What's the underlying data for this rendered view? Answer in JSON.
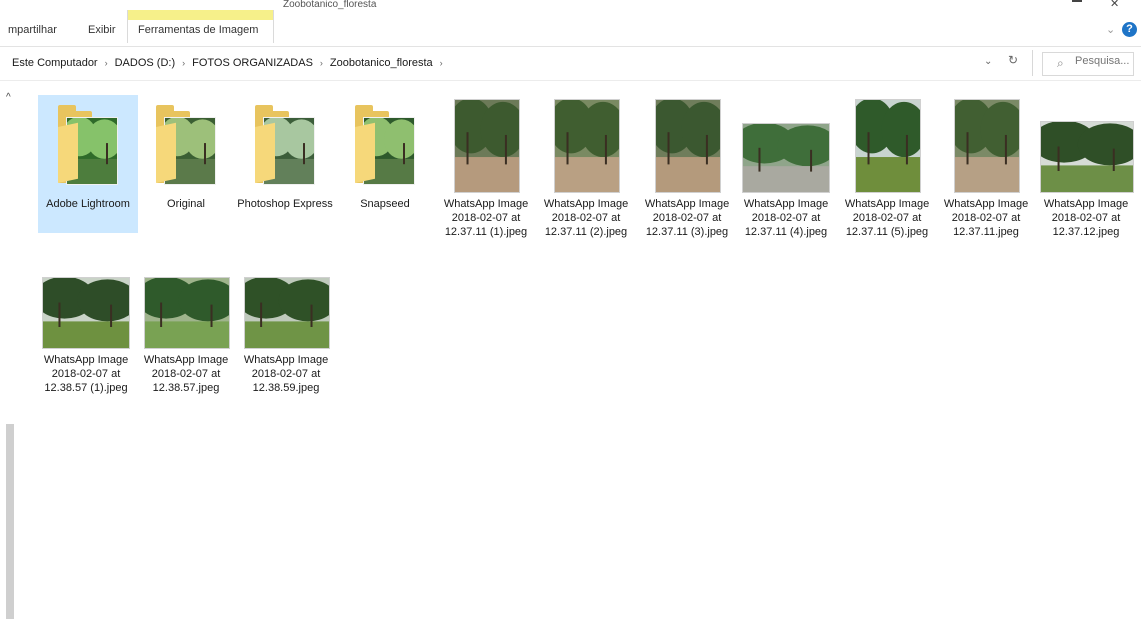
{
  "window": {
    "title": "Zoobotanico_floresta"
  },
  "ribbon": {
    "tabs": [
      {
        "label": "mpartilhar"
      },
      {
        "label": "Exibir"
      },
      {
        "label": "Ferramentas de Imagem"
      }
    ],
    "help_label": "?"
  },
  "address": {
    "crumbs": [
      "Este Computador",
      "DADOS (D:)",
      "FOTOS ORGANIZADAS",
      "Zoobotanico_floresta"
    ]
  },
  "search": {
    "placeholder": "Pesquisa..."
  },
  "colors": {
    "selection": "#cce8ff",
    "contextual_tab": "#f6f08a",
    "folder": "#e8c45e",
    "help": "#1e74c7"
  },
  "items": [
    {
      "label": "Adobe Lightroom",
      "type": "folder",
      "selected": true,
      "palette": [
        "#2f6b2a",
        "#86c26a",
        "#4d7d3d"
      ]
    },
    {
      "label": "Original",
      "type": "folder",
      "selected": false,
      "palette": [
        "#3b5f33",
        "#9dc07a",
        "#5b7a4a"
      ]
    },
    {
      "label": "Photoshop Express",
      "type": "folder",
      "selected": false,
      "palette": [
        "#3c5e3a",
        "#a8c7a0",
        "#62805a"
      ]
    },
    {
      "label": "Snapseed",
      "type": "folder",
      "selected": false,
      "palette": [
        "#2e5a2c",
        "#8fbf6f",
        "#567a45"
      ]
    },
    {
      "label": "WhatsApp Image 2018-02-07 at 12.37.11 (1).jpeg",
      "type": "photo",
      "orientation": "portrait",
      "palette": [
        "#6c7a58",
        "#3d5a2f",
        "#b59a7d"
      ]
    },
    {
      "label": "WhatsApp Image 2018-02-07 at 12.37.11 (2).jpeg",
      "type": "photo",
      "orientation": "portrait",
      "palette": [
        "#7a8a62",
        "#405e30",
        "#b9a083"
      ]
    },
    {
      "label": "WhatsApp Image 2018-02-07 at 12.37.11 (3).jpeg",
      "type": "photo",
      "orientation": "portrait",
      "palette": [
        "#6f7d5b",
        "#3b5830",
        "#b49a7c"
      ]
    },
    {
      "label": "WhatsApp Image 2018-02-07 at 12.37.11 (4).jpeg",
      "type": "photo",
      "orientation": "landscape",
      "palette": [
        "#8fa58a",
        "#3f6e3a",
        "#a9a9a0"
      ]
    },
    {
      "label": "WhatsApp Image 2018-02-07 at 12.37.11 (5).jpeg",
      "type": "photo",
      "orientation": "portrait",
      "palette": [
        "#c8d4cf",
        "#2f5a2a",
        "#6f8e3c"
      ]
    },
    {
      "label": "WhatsApp Image 2018-02-07 at 12.37.11.jpeg",
      "type": "photo",
      "orientation": "portrait",
      "palette": [
        "#7b8a66",
        "#415f32",
        "#b6a085"
      ]
    },
    {
      "label": "WhatsApp Image 2018-02-07 at 12.37.12.jpeg",
      "type": "photo",
      "orientation": "landscape",
      "palette": [
        "#d6dbd6",
        "#2f4f27",
        "#6d8f47"
      ]
    },
    {
      "label": "WhatsApp Image 2018-02-07 at 12.38.57 (1).jpeg",
      "type": "photo",
      "orientation": "landscape",
      "palette": [
        "#c9d3c7",
        "#2e4d28",
        "#6e9140"
      ]
    },
    {
      "label": "WhatsApp Image 2018-02-07 at 12.38.57.jpeg",
      "type": "photo",
      "orientation": "landscape",
      "palette": [
        "#9fb48c",
        "#2f5a2b",
        "#79a253"
      ]
    },
    {
      "label": "WhatsApp Image 2018-02-07 at 12.38.59.jpeg",
      "type": "photo",
      "orientation": "landscape",
      "palette": [
        "#bfcabc",
        "#2f5127",
        "#6f9446"
      ]
    }
  ]
}
